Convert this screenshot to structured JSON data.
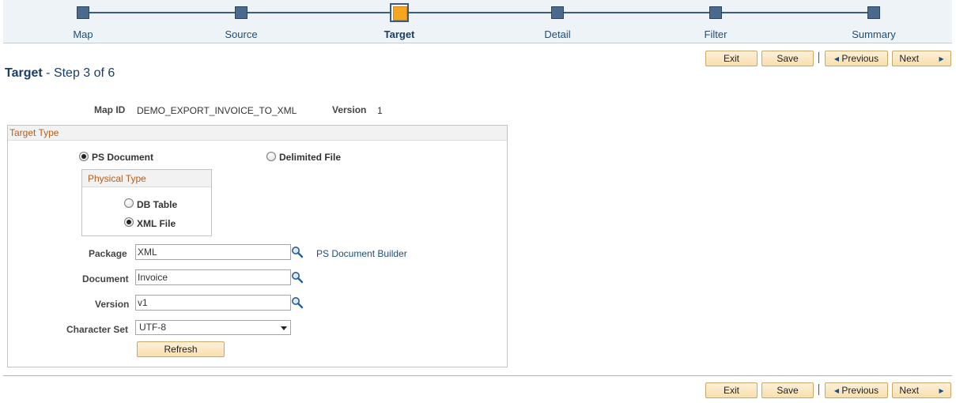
{
  "stepper": {
    "steps": [
      {
        "label": "Map"
      },
      {
        "label": "Source"
      },
      {
        "label": "Target"
      },
      {
        "label": "Detail"
      },
      {
        "label": "Filter"
      },
      {
        "label": "Summary"
      }
    ],
    "current": "Target"
  },
  "toolbar": {
    "exit_label": "Exit",
    "save_label": "Save",
    "previous_label": "Previous",
    "next_label": "Next"
  },
  "page": {
    "title": "Target",
    "subtitle": " - Step 3 of 6"
  },
  "map": {
    "map_id_label": "Map ID",
    "map_id_value": "DEMO_EXPORT_INVOICE_TO_XML",
    "version_label": "Version",
    "version_value": "1"
  },
  "target_type": {
    "header": "Target Type",
    "ps_document_label": "PS Document",
    "delimited_file_label": "Delimited File",
    "selected": "PS Document"
  },
  "physical_type": {
    "header": "Physical Type",
    "db_table_label": "DB Table",
    "xml_file_label": "XML File",
    "selected": "XML File"
  },
  "form": {
    "package_label": "Package",
    "package_value": "XML",
    "ps_document_builder_link": "PS Document Builder",
    "document_label": "Document",
    "document_value": "Invoice",
    "version_label": "Version",
    "version_value": "v1",
    "character_set_label": "Character Set",
    "character_set_value": "UTF-8",
    "refresh_label": "Refresh"
  },
  "icons": {
    "lookup": "magnifier-icon",
    "previous": "triangle-left-icon",
    "next": "triangle-right-icon"
  }
}
